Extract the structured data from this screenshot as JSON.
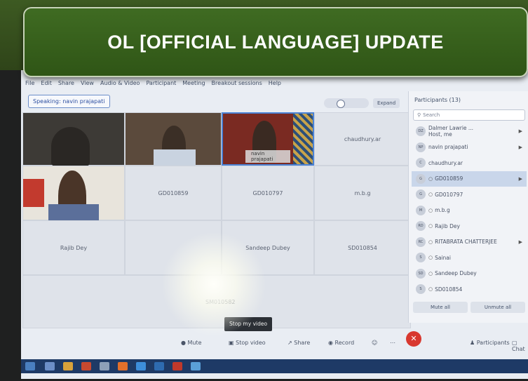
{
  "banner": {
    "title": "OL [OFFICIAL LANGUAGE] UPDATE"
  },
  "app": {
    "menu": [
      "File",
      "Edit",
      "Share",
      "View",
      "Audio & Video",
      "Participant",
      "Meeting",
      "Breakout sessions",
      "Help"
    ],
    "speaking_label": "Speaking:",
    "speaking_name": "navin prajapati",
    "expand_label": "Expand"
  },
  "tiles": {
    "t1": "",
    "t2": "",
    "t3_name": "navin prajapati",
    "t4": "chaudhury.ar",
    "t6": "GD010859",
    "t7": "GD010797",
    "t8": "m.b.g",
    "t9": "Rajib Dey",
    "t11": "Sandeep Dubey",
    "t12": "SD010854",
    "t13": "SM010582"
  },
  "participants": {
    "title": "Participants (13)",
    "search_placeholder": "Search",
    "items": [
      {
        "initials": "DZ",
        "name": "Dalmer Lawrie ...",
        "sub": "Host, me"
      },
      {
        "initials": "NP",
        "name": "navin prajapati"
      },
      {
        "initials": "C",
        "name": "chaudhury.ar"
      },
      {
        "initials": "G",
        "name": "GD010859"
      },
      {
        "initials": "G",
        "name": "GD010797"
      },
      {
        "initials": "M",
        "name": "m.b.g"
      },
      {
        "initials": "RD",
        "name": "Rajib Dey"
      },
      {
        "initials": "RC",
        "name": "RITABRATA CHATTERJEE"
      },
      {
        "initials": "S",
        "name": "Sainai"
      },
      {
        "initials": "SD",
        "name": "Sandeep Dubey"
      },
      {
        "initials": "S",
        "name": "SD010854"
      }
    ],
    "mute_all": "Mute all",
    "unmute_all": "Unmute all"
  },
  "tooltip": "Stop my video",
  "toolbar": {
    "mute": "Mute",
    "stop_video": "Stop video",
    "share": "Share",
    "record": "Record",
    "participants": "Participants",
    "chat": "Chat"
  },
  "colors": {
    "banner_green": "#3f6b22",
    "end_call_red": "#d8382f",
    "active_blue": "#4b83d6"
  }
}
